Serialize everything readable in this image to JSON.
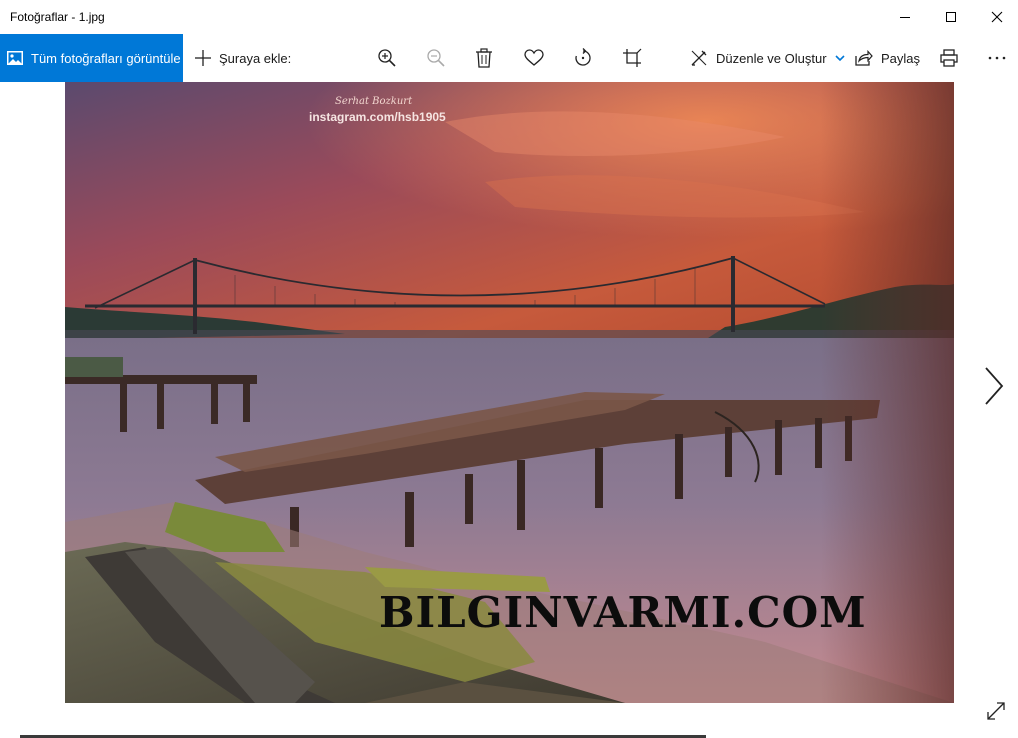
{
  "window": {
    "title": "Fotoğraflar - 1.jpg",
    "controls": {
      "minimize": "minimize-icon",
      "maximize": "maximize-icon",
      "close": "close-icon"
    }
  },
  "toolbar": {
    "view_all_label": "Tüm fotoğrafları görüntüle",
    "add_to_label": "Şuraya ekle:",
    "edit_create_label": "Düzenle ve Oluştur",
    "share_label": "Paylaş",
    "icons": [
      "zoom-in-icon",
      "zoom-out-icon",
      "delete-icon",
      "favorite-icon",
      "rotate-icon",
      "crop-icon",
      "print-icon",
      "more-icon"
    ],
    "accent_color": "#0078d7"
  },
  "photo": {
    "watermark_author": "Serhat Bozkurt",
    "watermark_instagram": "instagram.com/hsb1905",
    "watermark_site": "BILGINVARMI.COM"
  },
  "navigation": {
    "next": "chevron-right-icon",
    "fullscreen": "expand-icon"
  }
}
